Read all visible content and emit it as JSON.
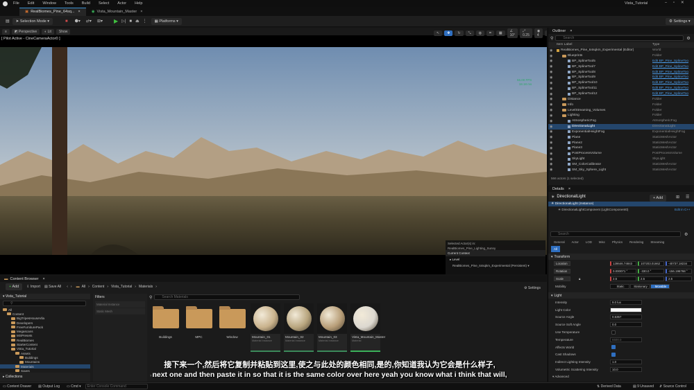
{
  "menu": [
    "File",
    "Edit",
    "Window",
    "Tools",
    "Build",
    "Select",
    "Actor",
    "Help"
  ],
  "window_title": "Vista_Tutorial",
  "tabs": [
    "RealBiomes_Pine_64sq...",
    "Vista_Mountain_Master"
  ],
  "toolbar": {
    "mode": "Selection Mode",
    "platforms": "Platforms",
    "settings": "Settings"
  },
  "viewport": {
    "perspective": "Perspective",
    "lit": "Lit",
    "show": "Show",
    "pilot": "[ Pilot Active - CineCameraActor0 ]",
    "fps": "55.00 FPS",
    "ms": "18.18 ms",
    "snap_values": [
      "10°",
      "0.25",
      "4"
    ],
    "selected_info": "Selected Actor(s) in:",
    "selected_level": "RealBiomes_Pine_Lighting_Sunny",
    "current_context": "Current Context",
    "level_label": "Level",
    "level_value": "RealBiomes_Pine_64sqkm_Experimental (Persistent)"
  },
  "outliner": {
    "title": "Outliner",
    "search": "Search",
    "col_label": "Item Label",
    "col_type": "Type",
    "rows": [
      {
        "name": "RealBiomes_Pine_64sqkm_Experimental (Editor)",
        "type": "World",
        "indent": 0,
        "kind": "world",
        "link": false
      },
      {
        "name": "Blueprints",
        "type": "Folder",
        "indent": 1,
        "kind": "folder",
        "link": false
      },
      {
        "name": "BP_SplineTool5",
        "type": "Edit BP_Pine_SplineToo",
        "indent": 2,
        "kind": "actor",
        "link": true
      },
      {
        "name": "BP_SplineTool7",
        "type": "Edit BP_Pine_SplineToo",
        "indent": 2,
        "kind": "actor",
        "link": true
      },
      {
        "name": "BP_SplineTool8",
        "type": "Edit BP_Pine_SplineToo",
        "indent": 2,
        "kind": "actor",
        "link": true
      },
      {
        "name": "BP_SplineTool9",
        "type": "Edit BP_Pine_SplineToo",
        "indent": 2,
        "kind": "actor",
        "link": true
      },
      {
        "name": "BP_SplineTool10",
        "type": "Edit BP_Pine_SplineToo",
        "indent": 2,
        "kind": "actor",
        "link": true
      },
      {
        "name": "BP_SplineTool11",
        "type": "Edit BP_Pine_SplineToo",
        "indent": 2,
        "kind": "actor",
        "link": true
      },
      {
        "name": "BP_SplineTool12",
        "type": "Edit BP_Pine_SplineToo",
        "indent": 2,
        "kind": "actor",
        "link": true
      },
      {
        "name": "Distance",
        "type": "Folder",
        "indent": 1,
        "kind": "folder",
        "link": false
      },
      {
        "name": "Info",
        "type": "Folder",
        "indent": 1,
        "kind": "folder",
        "link": false
      },
      {
        "name": "LevelStreaming_Volumes",
        "type": "Folder",
        "indent": 1,
        "kind": "folder",
        "link": false
      },
      {
        "name": "Lighting",
        "type": "Folder",
        "indent": 1,
        "kind": "folder",
        "link": false
      },
      {
        "name": "AtmosphericFog",
        "type": "AtmosphericFog",
        "indent": 2,
        "kind": "actor",
        "link": false
      },
      {
        "name": "DirectionalLight",
        "type": "DirectionalLight",
        "indent": 2,
        "kind": "actor",
        "link": false,
        "selected": true
      },
      {
        "name": "ExponentialHeightFog",
        "type": "ExponentialHeightFog",
        "indent": 2,
        "kind": "actor",
        "link": false
      },
      {
        "name": "Plane",
        "type": "StaticMeshActor",
        "indent": 2,
        "kind": "actor",
        "link": false
      },
      {
        "name": "Plane2",
        "type": "StaticMeshActor",
        "indent": 2,
        "kind": "actor",
        "link": false
      },
      {
        "name": "Plane3",
        "type": "StaticMeshActor",
        "indent": 2,
        "kind": "actor",
        "link": false
      },
      {
        "name": "PostProcessVolume",
        "type": "PostProcessVolume",
        "indent": 2,
        "kind": "actor",
        "link": false
      },
      {
        "name": "SkyLight",
        "type": "SkyLight",
        "indent": 2,
        "kind": "actor",
        "link": false
      },
      {
        "name": "SM_ColorCalibrator",
        "type": "StaticMeshActor",
        "indent": 2,
        "kind": "actor",
        "link": false
      },
      {
        "name": "SM_Sky_Sphere_Light",
        "type": "StaticMeshActor",
        "indent": 2,
        "kind": "actor",
        "link": false
      }
    ],
    "count": "566 actors (1 selected)"
  },
  "details": {
    "title": "Details",
    "actor": "DirectionalLight",
    "add": "+ Add",
    "instance": "DirectionalLight (Instance)",
    "component": "DirectionalLightComponent (LightComponent0)",
    "edit_cpp": "Edit in C++",
    "search": "Search",
    "tabs": [
      "General",
      "Actor",
      "LOD",
      "Misc",
      "Physics",
      "Rendering",
      "Streaming"
    ],
    "tab_all": "All",
    "transform": "Transform",
    "location_label": "Location",
    "location": [
      "128646.74843",
      "107203.01662",
      "-40737.18234"
    ],
    "rotation_label": "Rotation",
    "rotation": [
      "0.000071 °",
      "-330.0 °",
      "-156.196768 °"
    ],
    "scale_label": "Scale",
    "scale": [
      "2.5",
      "2.5",
      "2.5"
    ],
    "mobility_label": "Mobility",
    "mobility": [
      "Static",
      "Stationary",
      "Movable"
    ],
    "light_section": "Light",
    "props": [
      {
        "label": "Intensity",
        "value": "9.0 lux"
      },
      {
        "label": "Light Color",
        "value": ""
      },
      {
        "label": "Source Angle",
        "value": "0.5357"
      },
      {
        "label": "Source Soft Angle",
        "value": "0.0"
      },
      {
        "label": "Use Temperature",
        "value": ""
      },
      {
        "label": "Temperature",
        "value": "6500.0"
      },
      {
        "label": "Affects World",
        "value": ""
      },
      {
        "label": "Cast Shadows",
        "value": ""
      },
      {
        "label": "Indirect Lighting Intensity",
        "value": "1.0"
      },
      {
        "label": "Volumetric Scattering Intensity",
        "value": "10.0"
      }
    ],
    "advanced": "Advanced"
  },
  "content_browser": {
    "title": "Content Browser",
    "add": "Add",
    "import": "Import",
    "save_all": "Save All",
    "path": [
      "All",
      "Content",
      "Vista_Tutorial",
      "Materials"
    ],
    "settings": "Settings",
    "root": "Vista_Tutorial",
    "tree": [
      {
        "name": "All",
        "indent": 0
      },
      {
        "name": "Content",
        "indent": 1
      },
      {
        "name": "BigTripesHouseVila",
        "indent": 2
      },
      {
        "name": "Developers",
        "indent": 2
      },
      {
        "name": "FreeFurniturePack",
        "indent": 2
      },
      {
        "name": "Megascans",
        "indent": 2
      },
      {
        "name": "MSPresets",
        "indent": 2
      },
      {
        "name": "RealBiomes",
        "indent": 2
      },
      {
        "name": "StarterContent",
        "indent": 2
      },
      {
        "name": "Vista_Tutorial",
        "indent": 2
      },
      {
        "name": "Assets",
        "indent": 3
      },
      {
        "name": "Buildings",
        "indent": 4
      },
      {
        "name": "Mountains",
        "indent": 4
      },
      {
        "name": "Materials",
        "indent": 3,
        "selected": true
      },
      {
        "name": "Saves",
        "indent": 3
      },
      {
        "name": "Textures",
        "indent": 3
      }
    ],
    "filters": "Filters",
    "filter_items": [
      "Material Instance",
      "Static Mesh"
    ],
    "search": "Search Materials",
    "assets": [
      {
        "name": "Buildings",
        "sub": "",
        "kind": "folder"
      },
      {
        "name": "MPC",
        "sub": "",
        "kind": "folder"
      },
      {
        "name": "Window",
        "sub": "",
        "kind": "folder"
      },
      {
        "name": "Mountain_01",
        "sub": "Material Instance",
        "kind": "mat",
        "color": "#c9b28c"
      },
      {
        "name": "Mountain_02",
        "sub": "Material Instance",
        "kind": "mat",
        "color": "#b8a57e"
      },
      {
        "name": "Mountain_03",
        "sub": "Material Instance",
        "kind": "mat",
        "color": "#b89e78"
      },
      {
        "name": "Vista_Mountain_Master",
        "sub": "Material",
        "kind": "mat",
        "color": "#dcd8d0"
      }
    ],
    "item_count": "7 items",
    "collections": "Collections"
  },
  "subtitle": {
    "zh": "接下来一个,然后将它复制并粘贴到这里,使之与此处的颜色相同,是的,你知道我认为它会是什么样子,",
    "en": "next one and then paste it in so that it is the same color over here yeah you know what i think that will,"
  },
  "statusbar": {
    "content_drawer": "Content Drawer",
    "output_log": "Output Log",
    "cmd": "Cmd",
    "console": "Enter Console Command",
    "derived": "Derived Data",
    "unsaved": "9 Unsaved",
    "source": "Source Control"
  }
}
